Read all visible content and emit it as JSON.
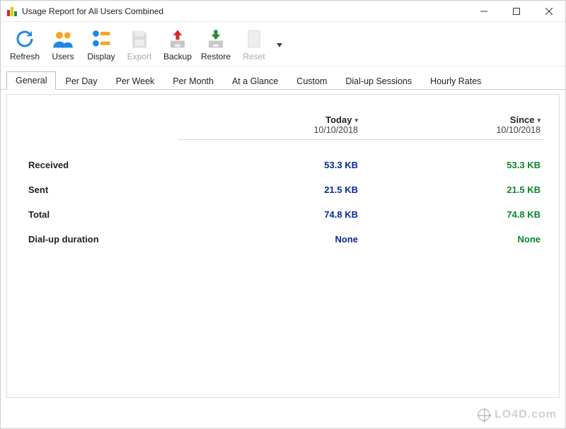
{
  "window": {
    "title": "Usage Report for All Users Combined"
  },
  "toolbar": {
    "refresh": "Refresh",
    "users": "Users",
    "display": "Display",
    "export": "Export",
    "backup": "Backup",
    "restore": "Restore",
    "reset": "Reset"
  },
  "tabs": {
    "general": "General",
    "per_day": "Per Day",
    "per_week": "Per Week",
    "per_month": "Per Month",
    "at_a_glance": "At a Glance",
    "custom": "Custom",
    "dialup_sessions": "Dial-up Sessions",
    "hourly_rates": "Hourly Rates"
  },
  "columns": {
    "today_label": "Today",
    "today_date": "10/10/2018",
    "since_label": "Since",
    "since_date": "10/10/2018"
  },
  "rows": {
    "received": {
      "label": "Received",
      "today": "53.3 KB",
      "since": "53.3 KB"
    },
    "sent": {
      "label": "Sent",
      "today": "21.5 KB",
      "since": "21.5 KB"
    },
    "total": {
      "label": "Total",
      "today": "74.8 KB",
      "since": "74.8 KB"
    },
    "dialup": {
      "label": "Dial-up duration",
      "today": "None",
      "since": "None"
    }
  },
  "watermark": "LO4D.com"
}
